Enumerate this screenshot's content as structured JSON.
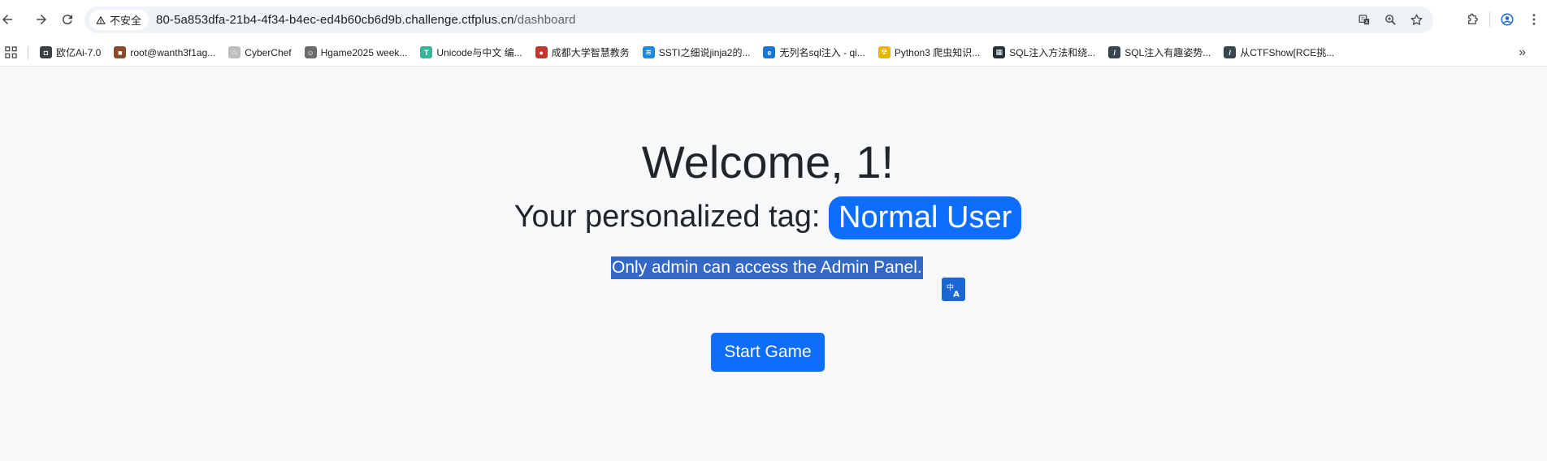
{
  "browser": {
    "security_label": "不安全",
    "url_host": "80-5a853dfa-21b4-4f34-b4ec-ed4b60cb6d9b.challenge.ctfplus.cn",
    "url_path": "/dashboard"
  },
  "bookmarks": [
    {
      "label": "欧亿Ai-7.0",
      "icon": "chat-icon",
      "color": "#3c4043"
    },
    {
      "label": "root@wanth3f1ag...",
      "icon": "avatar-icon",
      "color": "#8a4b2a"
    },
    {
      "label": "CyberChef",
      "icon": "chef-icon",
      "color": "#bdbdbd"
    },
    {
      "label": "Hgame2025 week...",
      "icon": "person-icon",
      "color": "#6b6b6b"
    },
    {
      "label": "Unicode与中文 编...",
      "icon": "t-icon",
      "color": "#35b59a"
    },
    {
      "label": "成都大学智慧教务",
      "icon": "seal-icon",
      "color": "#c0392b"
    },
    {
      "label": "SSTI之细说jinja2的...",
      "icon": "bird-icon",
      "color": "#1e88e5"
    },
    {
      "label": "无列名sql注入 - qi...",
      "icon": "blog-icon",
      "color": "#1976d2"
    },
    {
      "label": "Python3 爬虫知识...",
      "icon": "hazard-icon",
      "color": "#e8b400"
    },
    {
      "label": "SQL注入方法和绕...",
      "icon": "site-icon",
      "color": "#263238"
    },
    {
      "label": "SQL注入有趣姿势...",
      "icon": "slash-icon",
      "color": "#37474f"
    },
    {
      "label": "从CTFShow[RCE挑...",
      "icon": "slash-icon",
      "color": "#37474f"
    }
  ],
  "main": {
    "welcome": "Welcome, 1!",
    "tag_prefix": "Your personalized tag:",
    "tag_value": "Normal User",
    "notice": "Only admin can access the Admin Panel.",
    "start_button": "Start Game"
  },
  "colors": {
    "primary": "#0d6efd",
    "selection": "#3568c4",
    "page_bg": "#f7f8fa"
  }
}
